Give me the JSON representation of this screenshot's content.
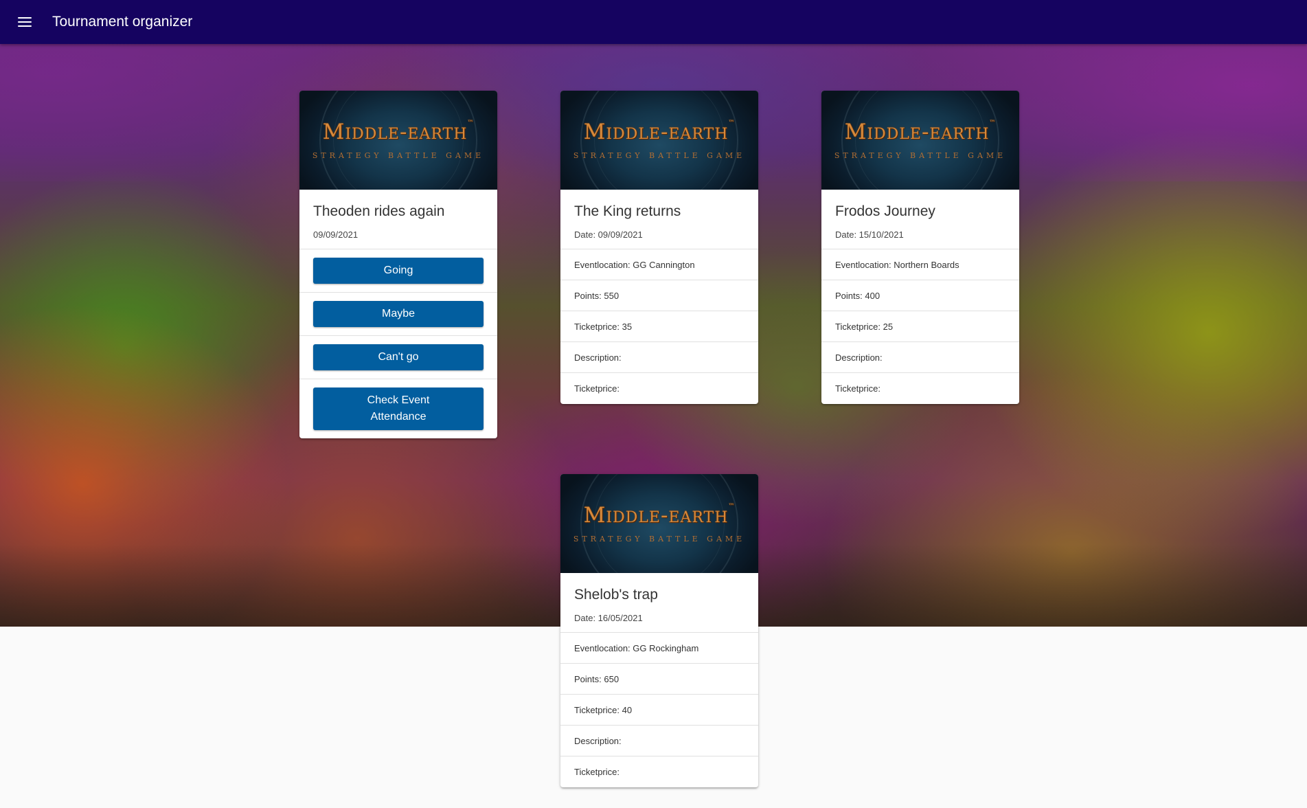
{
  "header": {
    "title": "Tournament organizer",
    "menu_icon": "menu-icon"
  },
  "brand": {
    "topbar_color": "#150360",
    "button_color": "#025e9f",
    "logo_color": "#d7893a"
  },
  "banner": {
    "logo_title": "Middle-earth",
    "logo_tm": "™",
    "logo_subtitle": "STRATEGY BATTLE GAME"
  },
  "cards": [
    {
      "title": "Theoden rides again",
      "date": "09/09/2021",
      "buttons": {
        "going": "Going",
        "maybe": "Maybe",
        "cant_go": "Can't go",
        "check_attendance": "Check Event Attendance"
      }
    },
    {
      "title": "The King returns",
      "date": "Date: 09/09/2021",
      "location": "Eventlocation: GG Cannington",
      "points": "Points: 550",
      "ticketprice": "Ticketprice: 35",
      "description": "Description:",
      "ticketprice2": "Ticketprice:"
    },
    {
      "title": "Frodos Journey",
      "date": "Date: 15/10/2021",
      "location": "Eventlocation: Northern Boards",
      "points": "Points: 400",
      "ticketprice": "Ticketprice: 25",
      "description": "Description:",
      "ticketprice2": "Ticketprice:"
    },
    {
      "title": "Shelob's trap",
      "date": "Date: 16/05/2021",
      "location": "Eventlocation: GG Rockingham",
      "points": "Points: 650",
      "ticketprice": "Ticketprice: 40",
      "description": "Description:",
      "ticketprice2": "Ticketprice:"
    }
  ]
}
